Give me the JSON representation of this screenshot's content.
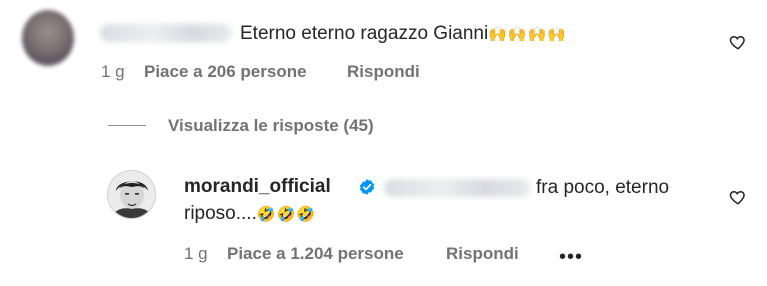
{
  "comment1": {
    "text": "Eterno eterno ragazzo Gianni",
    "emoji": "🙌🙌🙌🙌",
    "time": "1 g",
    "likes": "Piace a 206 persone",
    "reply": "Rispondi"
  },
  "thread": {
    "view_replies": "Visualizza le risposte (45)"
  },
  "reply1": {
    "username": "morandi_official",
    "text_line1": "fra poco, eterno",
    "text_line2": "riposo....",
    "emoji": "🤣🤣🤣",
    "time": "1 g",
    "likes": "Piace a 1.204 persone",
    "reply": "Rispondi",
    "more": "•••"
  },
  "icons": {
    "heart": "heart-outline-icon",
    "verified": "verified-badge-icon",
    "more": "more-options-icon"
  },
  "colors": {
    "text": "#262626",
    "secondary": "#737373",
    "verified": "#0095f6"
  }
}
